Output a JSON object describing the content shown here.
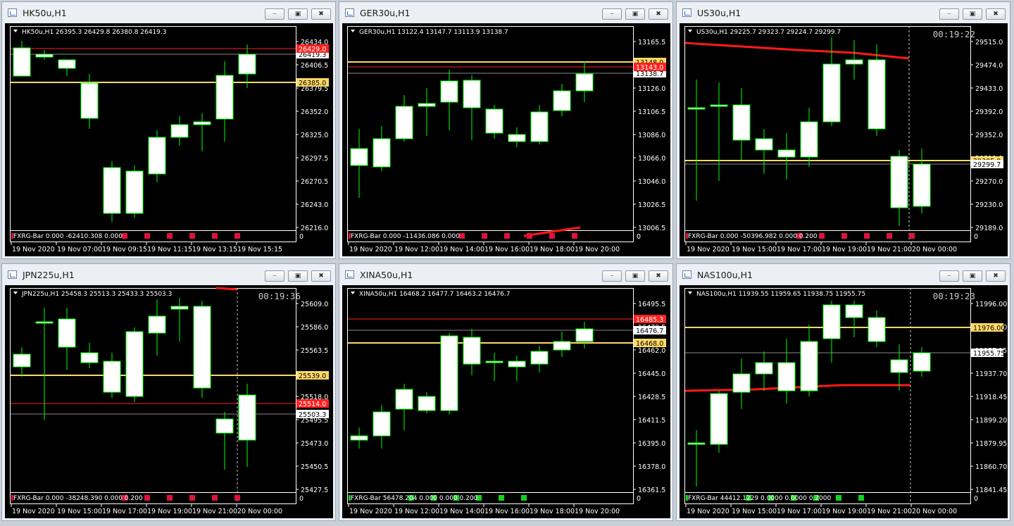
{
  "colors": {
    "bg": "#000000",
    "candle_up": "#ffffff",
    "candle_edge": "#00ff00",
    "grid_frame": "#ffffff",
    "bid_line": "#ffd966",
    "ask_line": "#ff2020",
    "ma_line": "#ff1a1a",
    "axis_text": "#ffffff",
    "marker_red": "#e0123b",
    "marker_green": "#12d41a"
  },
  "windows": [
    {
      "title": "HK50u,H1",
      "info": "HK50u,H1  26395.3 26429.8 26380.8 26419.3",
      "clock": "",
      "indicator": "FXRG-Bar 0.000 -62410.308 0.000",
      "ind_zero": "0",
      "yticks": [
        "26434.0",
        "26406.5",
        "26379.5",
        "26352.0",
        "26325.0",
        "26297.5",
        "26270.5",
        "26243.0",
        "26216.0"
      ],
      "xticks": [
        "19 Nov 2020",
        "19 Nov 07:00",
        "19 Nov 09:15",
        "19 Nov 11:15",
        "19 Nov 13:15",
        "19 Nov 15:15"
      ],
      "price_labels": [
        {
          "text": "26419.3",
          "type": "current"
        },
        {
          "text": "26385.0",
          "type": "bid"
        },
        {
          "text": "26429.0",
          "type": "ask"
        }
      ],
      "markers": "red"
    },
    {
      "title": "GER30u,H1",
      "info": "GER30u,H1  13122.4 13147.7 13113.9 13138.7",
      "clock": "",
      "indicator": "FXRG-Bar 0.000 -11436.086 0.000",
      "ind_zero": "0",
      "yticks": [
        "13165.5",
        "13146.0",
        "13126.0",
        "13106.5",
        "13086.0",
        "13066.0",
        "13046.0",
        "13026.5",
        "13006.5"
      ],
      "xticks": [
        "19 Nov 2020",
        "19 Nov 12:00",
        "19 Nov 14:00",
        "19 Nov 16:00",
        "19 Nov 18:00",
        "19 Nov 20:00"
      ],
      "price_labels": [
        {
          "text": "13148.0",
          "type": "bid"
        },
        {
          "text": "13138.7",
          "type": "current"
        },
        {
          "text": "13143.0",
          "type": "ask"
        }
      ],
      "markers": "red"
    },
    {
      "title": "US30u,H1",
      "info": "US30u,H1  29225.7 29323.7 29224.7 29299.7",
      "clock": "00:19:22",
      "indicator": "FXRG-Bar 0.000 -50396.982 0.000 0.200",
      "ind_zero": "0",
      "yticks": [
        "29515.0",
        "29474.0",
        "29433.0",
        "29392.0",
        "29352.0",
        "29311.0",
        "29270.0",
        "29230.0",
        "29189.0"
      ],
      "xticks": [
        "19 Nov 2020",
        "19 Nov 15:00",
        "19 Nov 17:00",
        "19 Nov 19:00",
        "19 Nov 21:00",
        "20 Nov 00:00"
      ],
      "price_labels": [
        {
          "text": "29305.0",
          "type": "bid"
        },
        {
          "text": "29299.7",
          "type": "current"
        }
      ],
      "markers": "red"
    },
    {
      "title": "JPN225u,H1",
      "info": "JPN225u,H1  25458.3 25513.3 25433.3 25503.3",
      "clock": "00:19:36",
      "indicator": "FXRG-Bar 0.000 -38248.390 0.000 0.200",
      "ind_zero": "0",
      "yticks": [
        "25609.0",
        "25586.0",
        "25563.5",
        "25541.0",
        "25518.0",
        "25495.5",
        "25473.0",
        "25450.5",
        "25427.5"
      ],
      "xticks": [
        "19 Nov 2020",
        "19 Nov 15:00",
        "19 Nov 17:00",
        "19 Nov 19:00",
        "19 Nov 21:00",
        "20 Nov 00:00"
      ],
      "price_labels": [
        {
          "text": "25539.0",
          "type": "bid"
        },
        {
          "text": "25514.0",
          "type": "ask"
        },
        {
          "text": "25503.3",
          "type": "current"
        }
      ],
      "markers": "red"
    },
    {
      "title": "XINA50u,H1",
      "info": "XINA50u,H1  16468.2 16477.7 16463.2 16476.7",
      "clock": "",
      "indicator": "FXRG-Bar 56478.204 0.000 0.000 0.200",
      "ind_zero": "0",
      "yticks": [
        "16495.5",
        "16478.5",
        "16462.0",
        "16445.0",
        "16428.5",
        "16411.5",
        "16395.0",
        "16378.0",
        "16361.5"
      ],
      "xticks": [
        "19 Nov 2020",
        "19 Nov 12:00",
        "19 Nov 14:00",
        "19 Nov 16:00",
        "19 Nov 18:00",
        "19 Nov 20:00"
      ],
      "price_labels": [
        {
          "text": "16485.3",
          "type": "ask"
        },
        {
          "text": "16476.7",
          "type": "current"
        },
        {
          "text": "16468.0",
          "type": "bid"
        }
      ],
      "markers": "green"
    },
    {
      "title": "NAS100u,H1",
      "info": "NAS100u,H1  11939.55 11959.65 11938.75 11955.75",
      "clock": "00:19:23",
      "indicator": "FXRG-Bar 44412.1229 0.0000 0.0000 0.2000",
      "ind_zero": "0",
      "yticks": [
        "11996.00",
        "11976.00",
        "11957.15",
        "11937.70",
        "11918.45",
        "11899.20",
        "11879.95",
        "11860.70",
        "11841.45"
      ],
      "xticks": [
        "19 Nov 2020",
        "19 Nov 15:00",
        "19 Nov 17:00",
        "19 Nov 19:00",
        "19 Nov 21:00",
        "20 Nov 00:00"
      ],
      "price_labels": [
        {
          "text": "11976.00",
          "type": "bid"
        },
        {
          "text": "11955.75",
          "type": "current"
        }
      ],
      "markers": "green"
    }
  ]
}
